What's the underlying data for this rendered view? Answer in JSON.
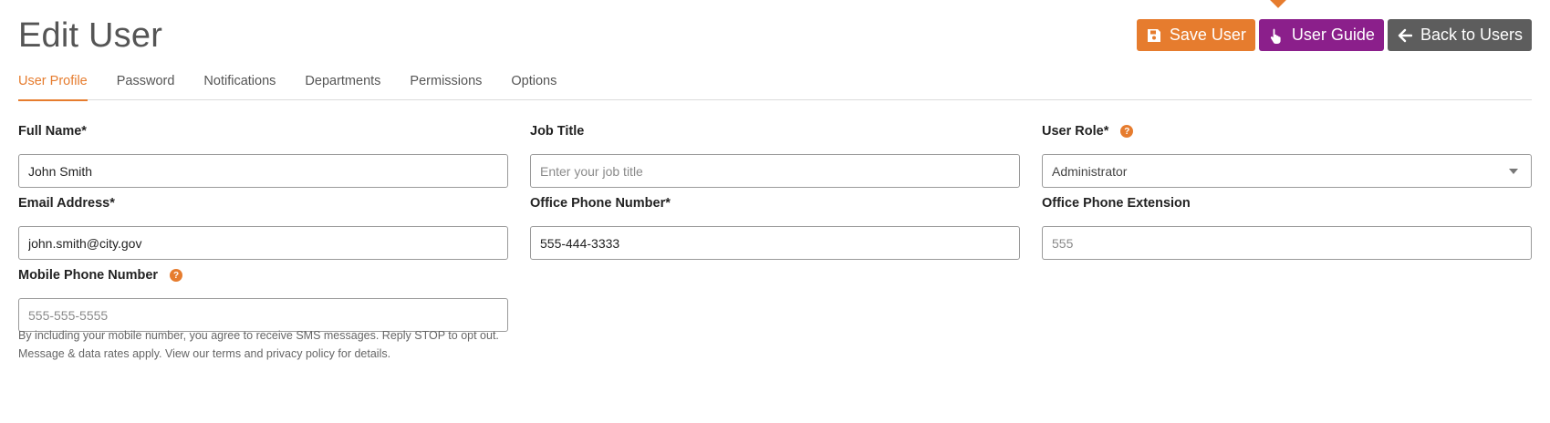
{
  "page": {
    "title": "Edit User"
  },
  "actions": {
    "save_label": "Save User",
    "guide_label": "User Guide",
    "back_label": "Back to Users"
  },
  "colors": {
    "accent": "#e67c2e",
    "guide": "#8b1f8b",
    "back": "#5d5d5d"
  },
  "icons": {
    "save": "floppy-disk-icon",
    "guide": "pointing-hand-icon",
    "back": "arrow-left-icon",
    "help": "question-circle-icon",
    "dropdown": "chevron-down-icon"
  },
  "tabs": [
    {
      "label": "User Profile",
      "active": true
    },
    {
      "label": "Password"
    },
    {
      "label": "Notifications"
    },
    {
      "label": "Departments"
    },
    {
      "label": "Permissions"
    },
    {
      "label": "Options"
    }
  ],
  "form": {
    "full_name": {
      "label": "Full Name*",
      "value": "John Smith"
    },
    "job_title": {
      "label": "Job Title",
      "value": "",
      "placeholder": "Enter your job title"
    },
    "user_role": {
      "label": "User Role*",
      "value": "Administrator"
    },
    "email": {
      "label": "Email Address*",
      "value": "john.smith@city.gov"
    },
    "office_phone": {
      "label": "Office Phone Number*",
      "value": "555-444-3333"
    },
    "office_ext": {
      "label": "Office Phone Extension",
      "value": "",
      "placeholder": "555"
    },
    "mobile_phone": {
      "label": "Mobile Phone Number",
      "value": "",
      "placeholder": "555-555-5555"
    },
    "sms_notice": {
      "line1": "By including your mobile number, you agree to receive SMS messages. Reply STOP to opt out.",
      "line2": "Message & data rates apply. View our terms and privacy policy for details."
    }
  }
}
